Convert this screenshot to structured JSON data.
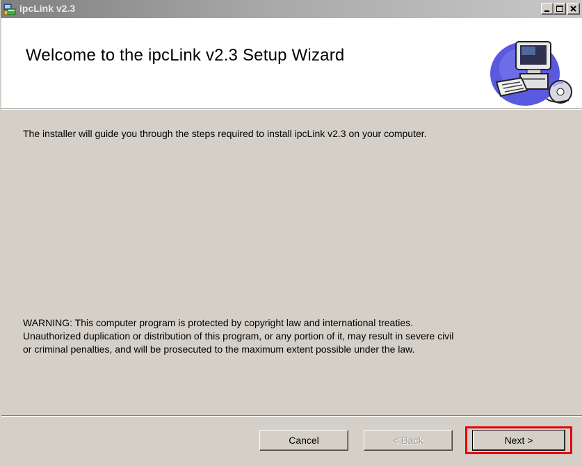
{
  "window": {
    "title": "ipcLink v2.3",
    "controls": [
      "minimize-icon",
      "maximize-icon",
      "close-icon"
    ]
  },
  "banner": {
    "title": "Welcome to the ipcLink v2.3 Setup Wizard",
    "art_icon": "computer-setup-icon"
  },
  "content": {
    "intro": "The installer will guide you through the steps required to install ipcLink v2.3 on your computer.",
    "warning_lines": [
      "WARNING: This computer program is protected by copyright law and international treaties.",
      "Unauthorized duplication or distribution of this program, or any portion of it, may result in severe civil",
      "or criminal penalties, and will be prosecuted to the maximum extent possible under the law."
    ]
  },
  "buttons": {
    "cancel": "Cancel",
    "back": "< Back",
    "next": "Next >"
  },
  "colors": {
    "dialog_bg": "#d4d0c8",
    "highlight": "#e8000b"
  }
}
